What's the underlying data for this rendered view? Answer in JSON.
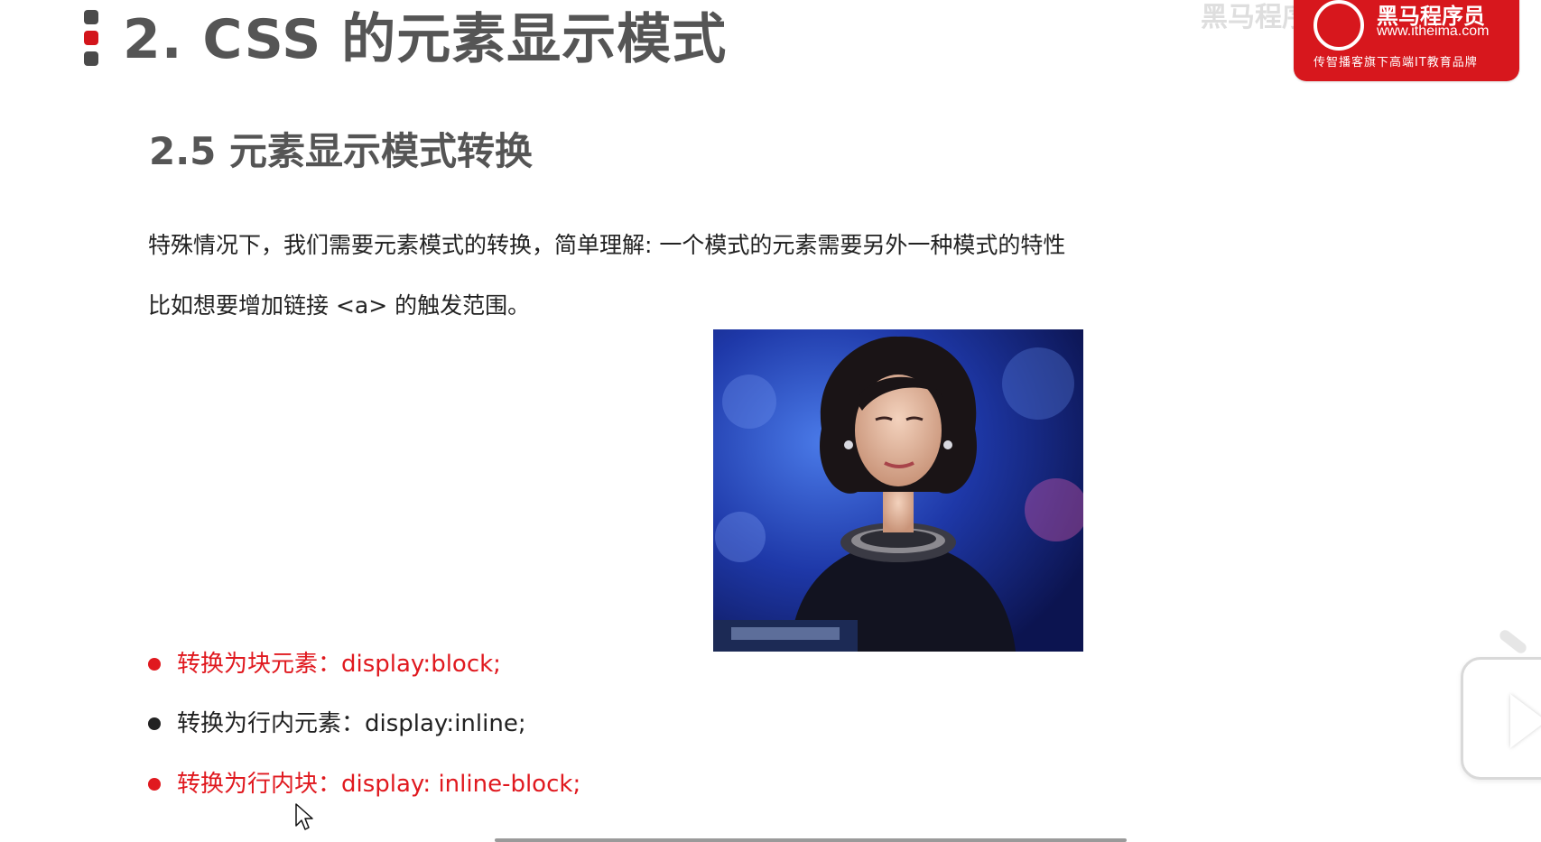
{
  "slide": {
    "title": "2. CSS 的元素显示模式",
    "subtitle": "2.5 元素显示模式转换",
    "paragraphs": [
      "特殊情况下，我们需要元素模式的转换，简单理解: 一个模式的元素需要另外一种模式的特性",
      "比如想要增加链接 <a> 的触发范围。"
    ],
    "bullets": [
      {
        "text": "转换为块元素：display:block;",
        "color": "#e0191f"
      },
      {
        "text": "转换为行内元素：display:inline;",
        "color": "#222222"
      },
      {
        "text": "转换为行内块：display: inline-block;",
        "color": "#e0191f"
      }
    ]
  },
  "logo": {
    "name": "黑马程序员",
    "url": "www.itheima.com",
    "slogan": "传智播客旗下高端IT教育品牌",
    "color": "#d7171d",
    "watermark": "黑马程序员 老师"
  },
  "icons": {
    "title_marker": "list-marker-icon",
    "floating": "play-icon",
    "cursor": "mouse-cursor-icon"
  },
  "colors": {
    "accent": "#e0191f",
    "title_text": "#555555",
    "body_text": "#222222"
  }
}
